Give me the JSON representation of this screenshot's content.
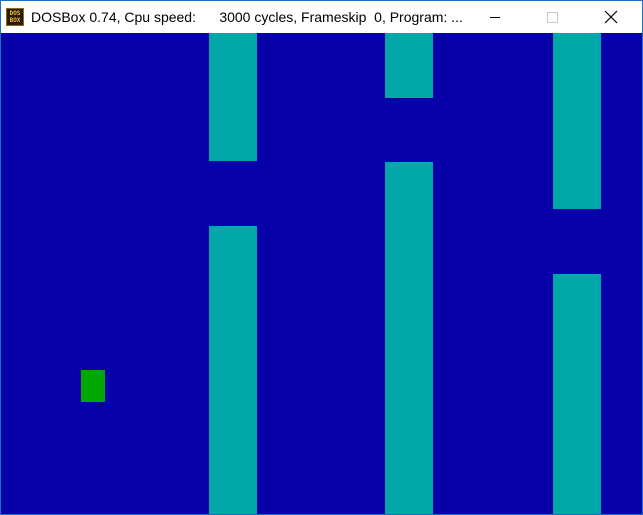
{
  "window": {
    "title": "DOSBox 0.74, Cpu speed:      3000 cycles, Frameskip  0, Program: ...",
    "icon_label": "DOS BOX",
    "icons": {
      "app": "dosbox-icon",
      "minimize": "minimize-icon",
      "maximize": "maximize-icon",
      "close": "close-icon"
    }
  },
  "game": {
    "background_color": "#0800a8",
    "pipe_color": "#00a8a8",
    "player_color": "#00a800"
  }
}
